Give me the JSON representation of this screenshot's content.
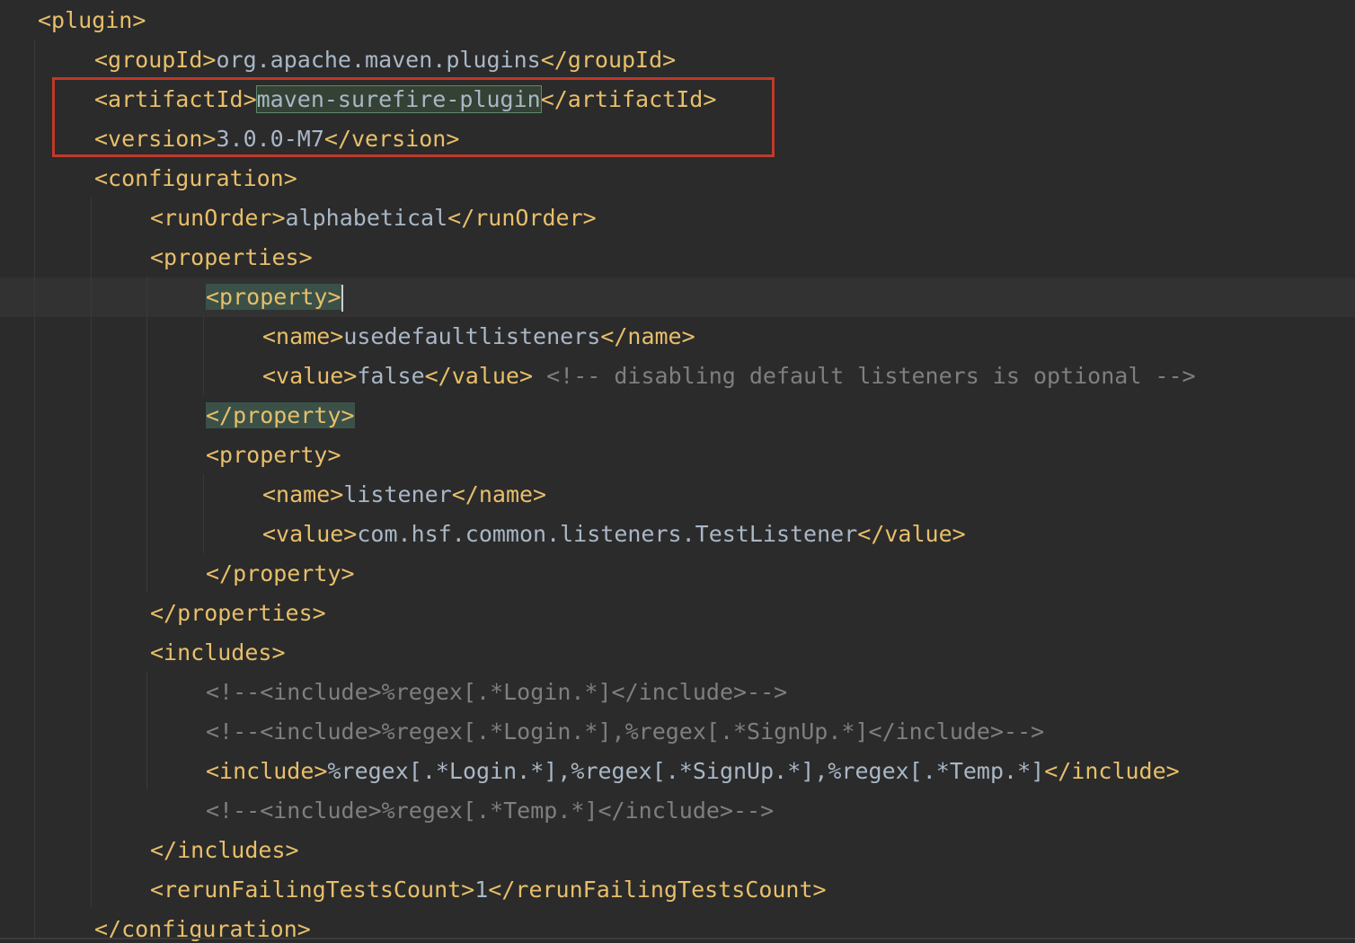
{
  "editor": {
    "language": "xml",
    "colors": {
      "background": "#2b2b2b",
      "tag": "#e8bf6a",
      "text": "#a9b7c6",
      "comment": "#7f7f7f",
      "annotation_box": "#c0392b",
      "match_highlight": "#344134",
      "tag_highlight": "#3b5148"
    },
    "lines": [
      {
        "indent": 1,
        "tokens": [
          {
            "type": "tag",
            "text": "<plugin>"
          }
        ]
      },
      {
        "indent": 2,
        "tokens": [
          {
            "type": "tag",
            "text": "<groupId>"
          },
          {
            "type": "text",
            "text": "org.apache.maven.plugins"
          },
          {
            "type": "tag",
            "text": "</groupId>"
          }
        ]
      },
      {
        "indent": 2,
        "tokens": [
          {
            "type": "tag",
            "text": "<artifactId>"
          },
          {
            "type": "text",
            "text": "maven-surefire-plugin",
            "highlight": "match"
          },
          {
            "type": "tag",
            "text": "</artifactId>"
          }
        ]
      },
      {
        "indent": 2,
        "tokens": [
          {
            "type": "tag",
            "text": "<version>"
          },
          {
            "type": "text",
            "text": "3.0.0-M7"
          },
          {
            "type": "tag",
            "text": "</version>"
          }
        ]
      },
      {
        "indent": 2,
        "tokens": [
          {
            "type": "tag",
            "text": "<configuration>"
          }
        ]
      },
      {
        "indent": 3,
        "tokens": [
          {
            "type": "tag",
            "text": "<runOrder>"
          },
          {
            "type": "text",
            "text": "alphabetical"
          },
          {
            "type": "tag",
            "text": "</runOrder>"
          }
        ]
      },
      {
        "indent": 3,
        "tokens": [
          {
            "type": "tag",
            "text": "<properties>"
          }
        ]
      },
      {
        "indent": 4,
        "current": true,
        "tokens": [
          {
            "type": "tag",
            "text": "<property>",
            "highlight": "tag"
          },
          {
            "type": "caret"
          }
        ]
      },
      {
        "indent": 5,
        "tokens": [
          {
            "type": "tag",
            "text": "<name>"
          },
          {
            "type": "text",
            "text": "usedefaultlisteners"
          },
          {
            "type": "tag",
            "text": "</name>"
          }
        ]
      },
      {
        "indent": 5,
        "tokens": [
          {
            "type": "tag",
            "text": "<value>"
          },
          {
            "type": "text",
            "text": "false"
          },
          {
            "type": "tag",
            "text": "</value>"
          },
          {
            "type": "text",
            "text": " "
          },
          {
            "type": "comment",
            "text": "<!-- disabling default listeners is optional -->"
          }
        ]
      },
      {
        "indent": 4,
        "tokens": [
          {
            "type": "tag",
            "text": "</property>",
            "highlight": "tag"
          }
        ]
      },
      {
        "indent": 4,
        "tokens": [
          {
            "type": "tag",
            "text": "<property>"
          }
        ]
      },
      {
        "indent": 5,
        "tokens": [
          {
            "type": "tag",
            "text": "<name>"
          },
          {
            "type": "text",
            "text": "listener"
          },
          {
            "type": "tag",
            "text": "</name>"
          }
        ]
      },
      {
        "indent": 5,
        "tokens": [
          {
            "type": "tag",
            "text": "<value>"
          },
          {
            "type": "text",
            "text": "com.hsf.common.listeners.TestListener"
          },
          {
            "type": "tag",
            "text": "</value>"
          }
        ]
      },
      {
        "indent": 4,
        "tokens": [
          {
            "type": "tag",
            "text": "</property>"
          }
        ]
      },
      {
        "indent": 3,
        "tokens": [
          {
            "type": "tag",
            "text": "</properties>"
          }
        ]
      },
      {
        "indent": 3,
        "tokens": [
          {
            "type": "tag",
            "text": "<includes>"
          }
        ]
      },
      {
        "indent": 4,
        "tokens": [
          {
            "type": "comment",
            "text": "<!--<include>%regex[.*Login.*]</include>-->"
          }
        ]
      },
      {
        "indent": 4,
        "tokens": [
          {
            "type": "comment",
            "text": "<!--<include>%regex[.*Login.*],%regex[.*SignUp.*]</include>-->"
          }
        ]
      },
      {
        "indent": 4,
        "tokens": [
          {
            "type": "tag",
            "text": "<include>"
          },
          {
            "type": "text",
            "text": "%regex[.*Login.*],%regex[.*SignUp.*],%regex[.*Temp.*]"
          },
          {
            "type": "tag",
            "text": "</include>"
          }
        ]
      },
      {
        "indent": 4,
        "tokens": [
          {
            "type": "comment",
            "text": "<!--<include>%regex[.*Temp.*]</include>-->"
          }
        ]
      },
      {
        "indent": 3,
        "tokens": [
          {
            "type": "tag",
            "text": "</includes>"
          }
        ]
      },
      {
        "indent": 3,
        "tokens": [
          {
            "type": "tag",
            "text": "<rerunFailingTestsCount>"
          },
          {
            "type": "text",
            "text": "1"
          },
          {
            "type": "tag",
            "text": "</rerunFailingTestsCount>"
          }
        ]
      },
      {
        "indent": 2,
        "tokens": [
          {
            "type": "tag",
            "text": "</configuration>"
          }
        ]
      }
    ]
  }
}
